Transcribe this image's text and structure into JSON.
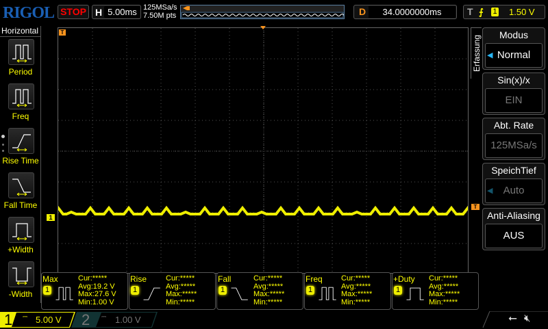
{
  "brand": "RIGOL",
  "run_state": "STOP",
  "horizontal": {
    "label": "H",
    "timebase": "5.00ms"
  },
  "acquisition": {
    "sample_rate": "125MSa/s",
    "memory": "7.50M pts"
  },
  "delay": {
    "label": "D",
    "value": "34.0000000ms"
  },
  "trigger": {
    "label": "T",
    "source": "1",
    "level": "1.50 V",
    "slope": "rising-edge-icon"
  },
  "left_menu": {
    "title": "Horizontal",
    "items": [
      {
        "label": "Period",
        "icon": "period-icon"
      },
      {
        "label": "Freq",
        "icon": "frequency-icon"
      },
      {
        "label": "Rise Time",
        "icon": "rise-time-icon"
      },
      {
        "label": "Fall Time",
        "icon": "fall-time-icon"
      },
      {
        "label": "+Width",
        "icon": "positive-width-icon"
      },
      {
        "label": "-Width",
        "icon": "negative-width-icon"
      }
    ]
  },
  "right_menu": {
    "tab": "Erfassung",
    "items": [
      {
        "title": "Modus",
        "value": "Normal",
        "enabled": true
      },
      {
        "title": "Sin(x)/x",
        "value": "EIN",
        "enabled": false
      },
      {
        "title": "Abt. Rate",
        "value": "125MSa/s",
        "enabled": false
      },
      {
        "title": "SpeichTief",
        "value": "Auto",
        "enabled": false
      },
      {
        "title": "Anti-Aliasing",
        "value": "AUS",
        "enabled": true
      }
    ]
  },
  "markers": {
    "channel1": "1",
    "trigger_pos": "T",
    "trigger_level": "T"
  },
  "measurements": [
    {
      "name": "Max",
      "channel": "1",
      "cur": "Cur:*****",
      "avg": "Avg:19.2 V",
      "max": "Max:27.6 V",
      "min": "Min:1.00 V"
    },
    {
      "name": "Rise",
      "channel": "1",
      "cur": "Cur:*****",
      "avg": "Avg:*****",
      "max": "Max:*****",
      "min": "Min:*****"
    },
    {
      "name": "Fall",
      "channel": "1",
      "cur": "Cur:*****",
      "avg": "Avg:*****",
      "max": "Max:*****",
      "min": "Min:*****"
    },
    {
      "name": "Freq",
      "channel": "1",
      "cur": "Cur:*****",
      "avg": "Avg:*****",
      "max": "Max:*****",
      "min": "Min:*****"
    },
    {
      "name": "+Duty",
      "channel": "1",
      "cur": "Cur:*****",
      "avg": "Avg:*****",
      "max": "Max:*****",
      "min": "Min:*****"
    }
  ],
  "channels": [
    {
      "num": "1",
      "scale": "5.00 V",
      "coupling": "DC",
      "color": "#ffff00",
      "active": true
    },
    {
      "num": "2",
      "scale": "1.00 V",
      "coupling": "DC",
      "color": "#888888",
      "active": false
    }
  ],
  "colors": {
    "ch1": "#ffff00",
    "accent": "#f7931e",
    "brand": "#1a5fb4",
    "stop": "#ff0000"
  }
}
